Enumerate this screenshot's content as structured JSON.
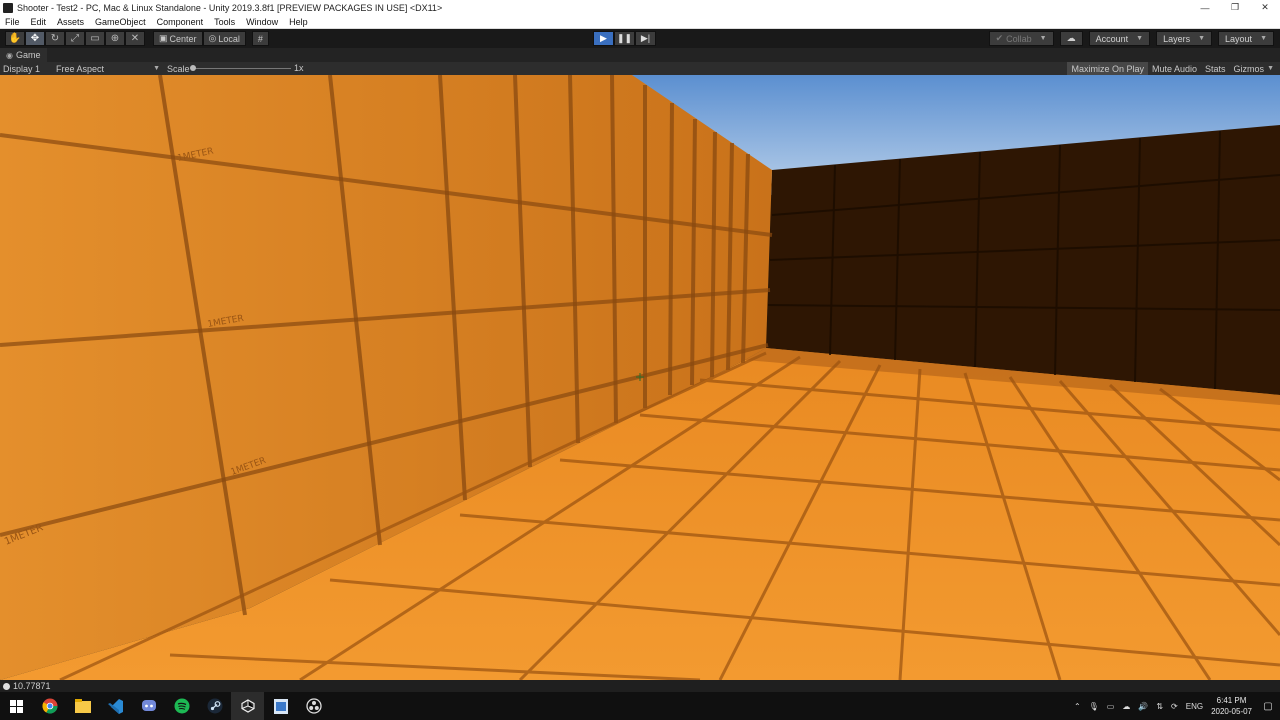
{
  "window": {
    "title": "Shooter - Test2 - PC, Mac & Linux Standalone - Unity 2019.3.8f1 [PREVIEW PACKAGES IN USE] <DX11>",
    "minimize": "—",
    "maximize": "❐",
    "close": "✕"
  },
  "menu": {
    "items": [
      "File",
      "Edit",
      "Assets",
      "GameObject",
      "Component",
      "Tools",
      "Window",
      "Help"
    ]
  },
  "toolbar": {
    "pivot_label": "Center",
    "space_label": "Local",
    "collab_label": "Collab",
    "account_label": "Account",
    "layers_label": "Layers",
    "layout_label": "Layout"
  },
  "game_tab": {
    "tab_label": "Game",
    "display_label": "Display 1",
    "aspect_label": "Free Aspect",
    "scale_label": "Scale",
    "scale_value": "1x",
    "maximize_label": "Maximize On Play",
    "mute_label": "Mute Audio",
    "stats_label": "Stats",
    "gizmos_label": "Gizmos"
  },
  "scene": {
    "wall_texture_label": "1METER",
    "sky_color": "#7ea8dc",
    "wall_color": "#e08a24",
    "floor_color": "#f0922a",
    "dark_wall_color": "#2e1603"
  },
  "status": {
    "log_text": "10.77871"
  },
  "taskbar": {
    "language": "ENG",
    "time": "6:41 PM",
    "date": "2020-05-07"
  }
}
